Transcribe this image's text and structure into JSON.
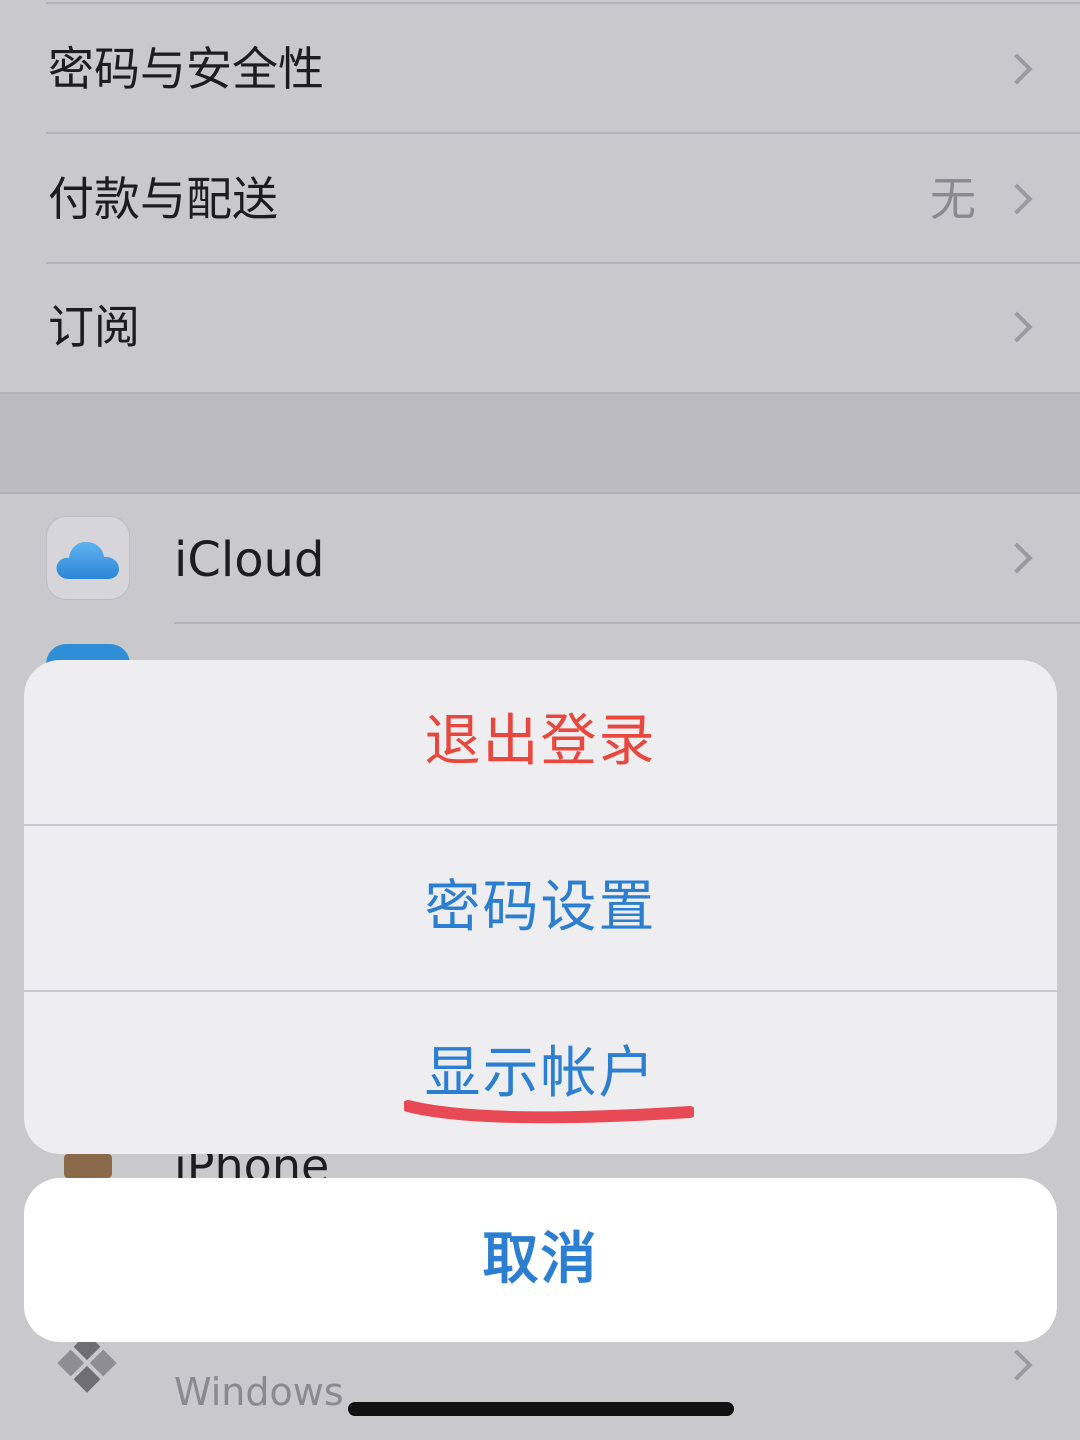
{
  "settings": {
    "rows": [
      {
        "label": "密码与安全性",
        "value": ""
      },
      {
        "label": "付款与配送",
        "value": "无"
      },
      {
        "label": "订阅",
        "value": ""
      }
    ],
    "icloud_label": "iCloud",
    "iphone_label": "iPhone",
    "windows_sub": "Windows"
  },
  "action_sheet": {
    "sign_out": "退出登录",
    "password_settings": "密码设置",
    "show_account": "显示帐户",
    "cancel": "取消"
  },
  "colors": {
    "destructive": "#e8473e",
    "accent": "#2c7fd0",
    "annotation": "#e84a55"
  }
}
